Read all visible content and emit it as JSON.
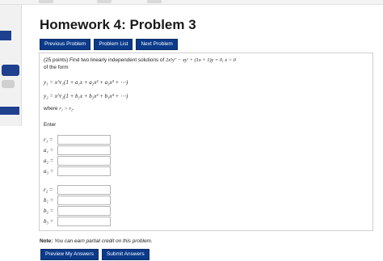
{
  "title": "Homework 4: Problem 3",
  "nav": {
    "previous": "Previous Problem",
    "list": "Problem List",
    "next": "Next Problem"
  },
  "problem": {
    "points": "(25 points)",
    "intro": "Find two linearly independent solutions of",
    "equation": "2x²y″ − xy′ + (1x + 1)y = 0, x > 0",
    "of_the_form": "of the form",
    "y1": "y₁ = x^r₁(1 + a₁x + a₂x² + a₃x³ + ⋯)",
    "y2": "y₂ = x^r₂(1 + b₁x + b₂x² + b₃x³ + ⋯)",
    "where_label": "where",
    "where_cond": "r₁ > r₂.",
    "enter": "Enter"
  },
  "answers_group1": [
    {
      "label": "r₁ =",
      "value": ""
    },
    {
      "label": "a₁ =",
      "value": ""
    },
    {
      "label": "a₂ =",
      "value": ""
    },
    {
      "label": "a₃ =",
      "value": ""
    }
  ],
  "answers_group2": [
    {
      "label": "r₂ =",
      "value": ""
    },
    {
      "label": "b₁ =",
      "value": ""
    },
    {
      "label": "b₂ =",
      "value": ""
    },
    {
      "label": "b₃ =",
      "value": ""
    }
  ],
  "note": {
    "label": "Note:",
    "text": "You can earn partial credit on this problem."
  },
  "buttons": {
    "preview": "Preview My Answers",
    "submit": "Submit Answers"
  },
  "colors": {
    "button_bg": "#0b3a8a",
    "sidebar_accent": "#1f3f8f"
  }
}
